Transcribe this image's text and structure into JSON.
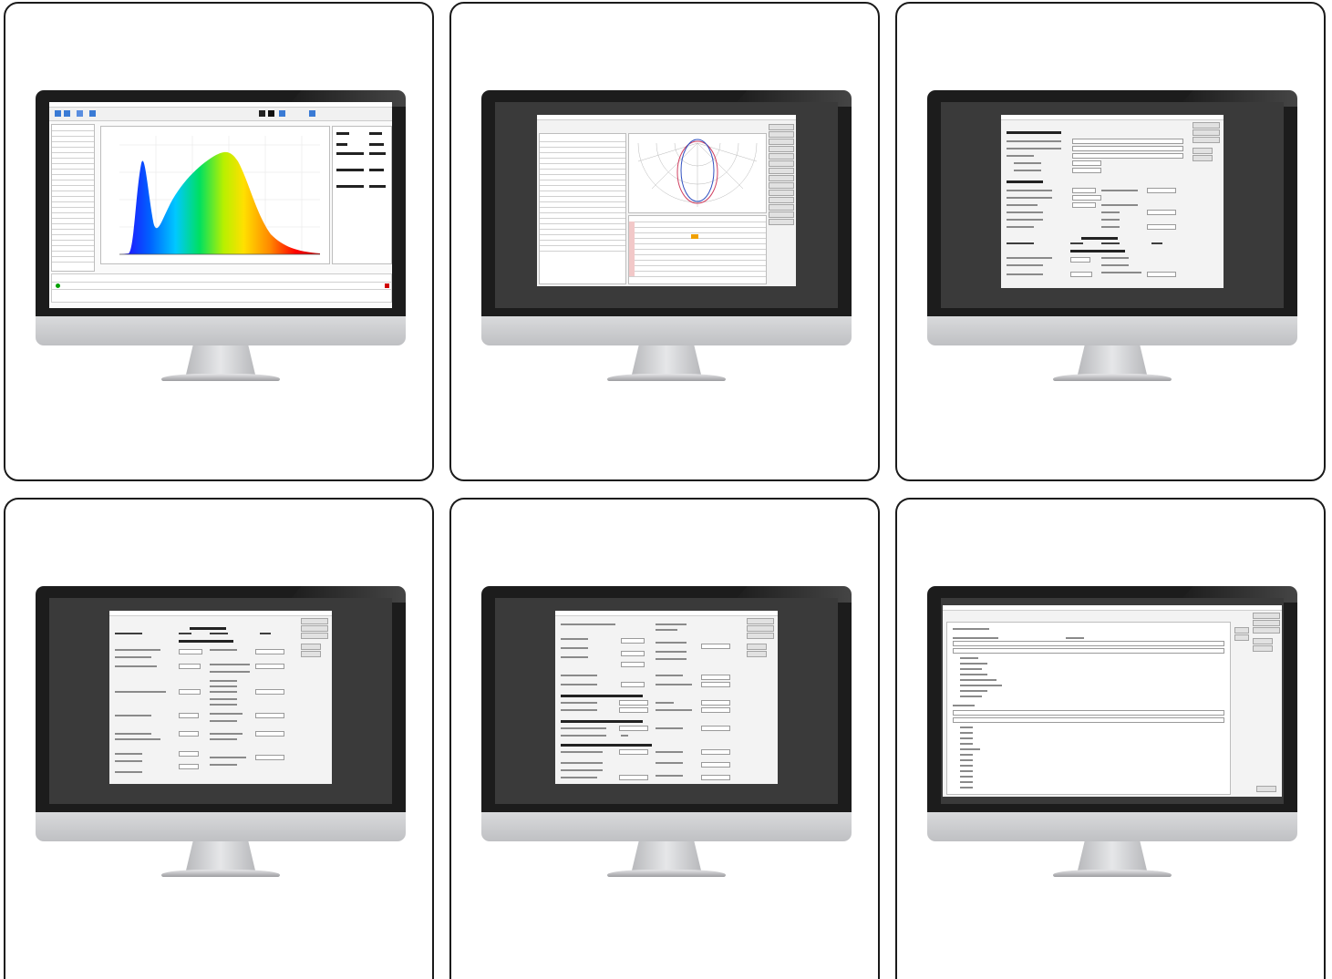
{
  "figure": {
    "panels": [
      {
        "id": 1,
        "screen": "spectrum-analysis"
      },
      {
        "id": 2,
        "screen": "polar-light-distribution"
      },
      {
        "id": 3,
        "screen": "product-information-sheet"
      },
      {
        "id": 4,
        "screen": "product-parameters"
      },
      {
        "id": 5,
        "screen": "directional-light-parameters"
      },
      {
        "id": 6,
        "screen": "information-list"
      }
    ],
    "colors": {
      "card_border": "#1a1a1a",
      "bezel": "#1c1c1c",
      "desktop": "#3a3a3a",
      "window": "#f3f3f3",
      "spectrum_gradient": [
        "#2a00ff",
        "#0060ff",
        "#00c8ff",
        "#00e060",
        "#b8f000",
        "#ffe000",
        "#ff8800",
        "#ff0000"
      ]
    }
  }
}
